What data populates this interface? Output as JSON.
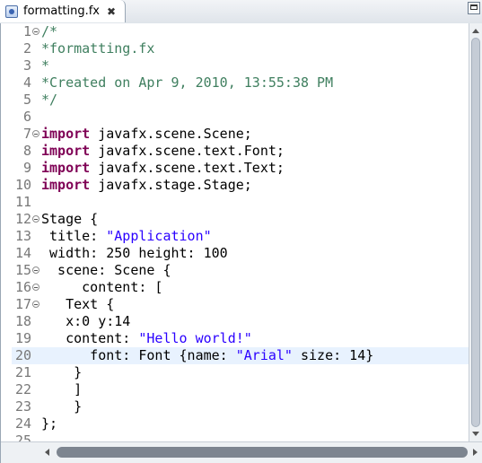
{
  "tab": {
    "icon": "javafx-file-icon",
    "label": "formatting.fx",
    "close_glyph": "✖"
  },
  "editor": {
    "current_line": 20,
    "lines": [
      {
        "num": "1",
        "fold": true,
        "tokens": [
          {
            "t": "comment",
            "v": "/*"
          }
        ]
      },
      {
        "num": "2",
        "fold": false,
        "tokens": [
          {
            "t": "comment",
            "v": "*formatting.fx"
          }
        ]
      },
      {
        "num": "3",
        "fold": false,
        "tokens": [
          {
            "t": "comment",
            "v": "*"
          }
        ]
      },
      {
        "num": "4",
        "fold": false,
        "tokens": [
          {
            "t": "comment",
            "v": "*Created on Apr 9, 2010, 13:55:38 PM"
          }
        ]
      },
      {
        "num": "5",
        "fold": false,
        "tokens": [
          {
            "t": "comment",
            "v": "*/"
          }
        ]
      },
      {
        "num": "6",
        "fold": false,
        "tokens": []
      },
      {
        "num": "7",
        "fold": true,
        "tokens": [
          {
            "t": "kw",
            "v": "import"
          },
          {
            "t": "plain",
            "v": " javafx.scene.Scene;"
          }
        ]
      },
      {
        "num": "8",
        "fold": false,
        "tokens": [
          {
            "t": "kw",
            "v": "import"
          },
          {
            "t": "plain",
            "v": " javafx.scene.text.Font;"
          }
        ]
      },
      {
        "num": "9",
        "fold": false,
        "tokens": [
          {
            "t": "kw",
            "v": "import"
          },
          {
            "t": "plain",
            "v": " javafx.scene.text.Text;"
          }
        ]
      },
      {
        "num": "10",
        "fold": false,
        "tokens": [
          {
            "t": "kw",
            "v": "import"
          },
          {
            "t": "plain",
            "v": " javafx.stage.Stage;"
          }
        ]
      },
      {
        "num": "11",
        "fold": false,
        "tokens": []
      },
      {
        "num": "12",
        "fold": true,
        "tokens": [
          {
            "t": "plain",
            "v": "Stage {"
          }
        ]
      },
      {
        "num": "13",
        "fold": false,
        "tokens": [
          {
            "t": "plain",
            "v": " title: "
          },
          {
            "t": "str",
            "v": "\"Application\""
          }
        ]
      },
      {
        "num": "14",
        "fold": false,
        "tokens": [
          {
            "t": "plain",
            "v": " width: 250 height: 100"
          }
        ]
      },
      {
        "num": "15",
        "fold": true,
        "tokens": [
          {
            "t": "plain",
            "v": "  scene: Scene {"
          }
        ]
      },
      {
        "num": "16",
        "fold": true,
        "tokens": [
          {
            "t": "plain",
            "v": "     content: ["
          }
        ]
      },
      {
        "num": "17",
        "fold": true,
        "tokens": [
          {
            "t": "plain",
            "v": "   Text {"
          }
        ]
      },
      {
        "num": "18",
        "fold": false,
        "tokens": [
          {
            "t": "plain",
            "v": "   x:0 y:14"
          }
        ]
      },
      {
        "num": "19",
        "fold": false,
        "tokens": [
          {
            "t": "plain",
            "v": "   content: "
          },
          {
            "t": "str",
            "v": "\"Hello world!\""
          }
        ]
      },
      {
        "num": "20",
        "fold": false,
        "tokens": [
          {
            "t": "plain",
            "v": "      font: Font {name: "
          },
          {
            "t": "str",
            "v": "\"Arial\""
          },
          {
            "t": "plain",
            "v": " size: 14}"
          }
        ]
      },
      {
        "num": "21",
        "fold": false,
        "tokens": [
          {
            "t": "plain",
            "v": "    }"
          }
        ]
      },
      {
        "num": "22",
        "fold": false,
        "tokens": [
          {
            "t": "plain",
            "v": "    ]"
          }
        ]
      },
      {
        "num": "23",
        "fold": false,
        "tokens": [
          {
            "t": "plain",
            "v": "    }"
          }
        ]
      },
      {
        "num": "24",
        "fold": false,
        "tokens": [
          {
            "t": "plain",
            "v": "};"
          }
        ]
      },
      {
        "num": "25",
        "fold": false,
        "tokens": []
      }
    ]
  },
  "colors": {
    "comment": "#3f7f5f",
    "keyword": "#7f0055",
    "string": "#2a00ff",
    "current_line_bg": "#e8f2fe",
    "line_number": "#787878"
  }
}
